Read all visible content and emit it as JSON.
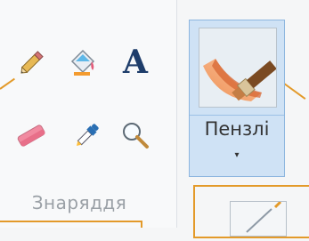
{
  "tools_group": {
    "label": "Знаряддя",
    "items": [
      {
        "icon": "pencil-icon"
      },
      {
        "icon": "fill-bucket-icon"
      },
      {
        "icon": "text-icon",
        "glyph": "A"
      },
      {
        "icon": "eraser-icon"
      },
      {
        "icon": "color-picker-icon"
      },
      {
        "icon": "magnifier-icon"
      }
    ]
  },
  "brushes": {
    "label": "Пензлі",
    "dropdown_glyph": "▾",
    "icon": "brush-icon"
  },
  "colors": {
    "callout": "#e39a2a",
    "selected_bg": "#cfe2f5",
    "selected_border": "#8db6df"
  }
}
